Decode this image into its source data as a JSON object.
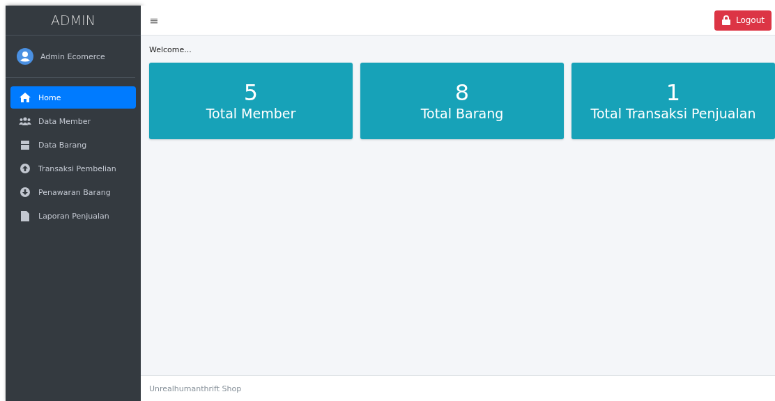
{
  "sidebar": {
    "brand": "ADMIN",
    "user": "Admin Ecomerce",
    "items": [
      {
        "label": "Home",
        "selected": true
      },
      {
        "label": "Data Member",
        "selected": false
      },
      {
        "label": "Data Barang",
        "selected": false
      },
      {
        "label": "Transaksi Pembelian",
        "selected": false
      },
      {
        "label": "Penawaran Barang",
        "selected": false
      },
      {
        "label": "Laporan Penjualan",
        "selected": false
      }
    ]
  },
  "topbar": {
    "menu_glyph": "≡",
    "logout": "Logout"
  },
  "welcome": "Welcome...",
  "cards": [
    {
      "value": "5",
      "label": "Total Member"
    },
    {
      "value": "8",
      "label": "Total Barang"
    },
    {
      "value": "1",
      "label": "Total Transaksi Penjualan"
    }
  ],
  "footer": "Unrealhumanthrift Shop"
}
